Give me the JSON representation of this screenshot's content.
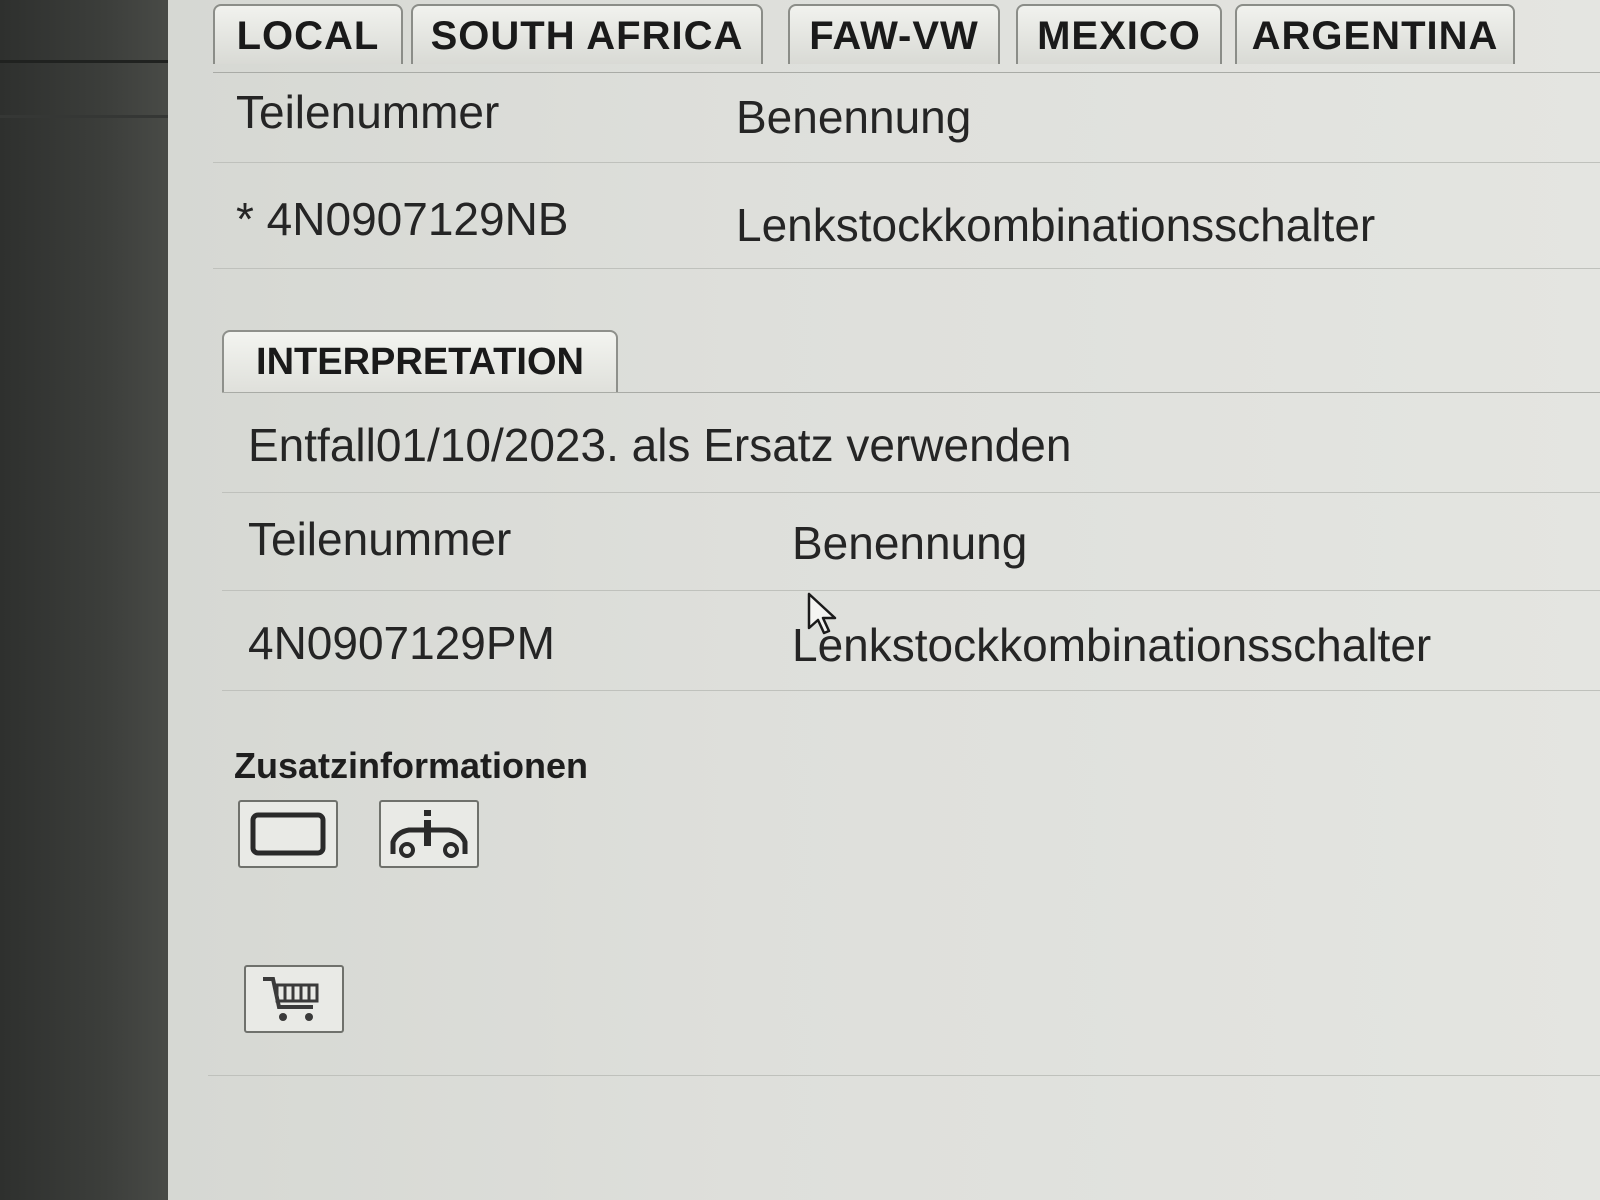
{
  "tabs": [
    "LOCAL",
    "SOUTH AFRICA",
    "FAW-VW",
    "MEXICO",
    "ARGENTINA"
  ],
  "parts_table": {
    "headers": {
      "part_number": "Teilenummer",
      "designation": "Benennung"
    },
    "row": {
      "part_number": "* 4N0907129NB",
      "designation": "Lenkstockkombinationsschalter"
    }
  },
  "interpretation": {
    "tab_label": "INTERPRETATION",
    "text": "Entfall01/10/2023. als Ersatz verwenden",
    "headers": {
      "part_number": "Teilenummer",
      "designation": "Benennung"
    },
    "row": {
      "part_number": "4N0907129PM",
      "designation": "Lenkstockkombinationsschalter"
    }
  },
  "additional_info": {
    "heading": "Zusatzinformationen",
    "icons": [
      "book-icon",
      "vehicle-info-icon"
    ],
    "cart_icon": "shopping-cart-icon"
  }
}
